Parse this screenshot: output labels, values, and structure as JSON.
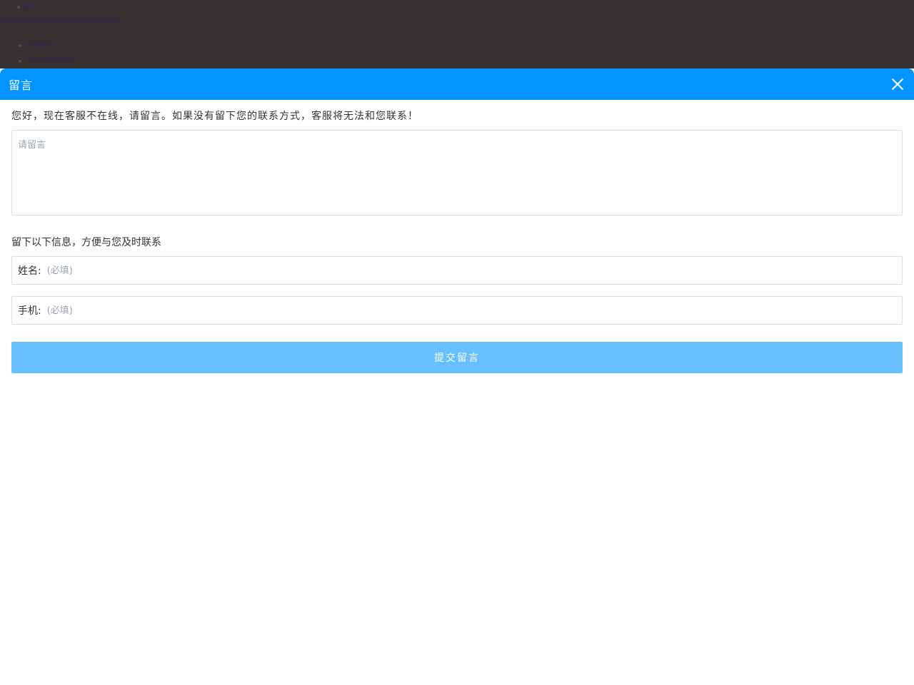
{
  "dialog": {
    "title": "留言",
    "notice": "您好，现在客服不在线，请留言。如果没有留下您的联系方式，客服将无法和您联系！",
    "message_placeholder": "请留言",
    "contact_prompt": "留下以下信息，方便与您及时联系",
    "fields": [
      {
        "label": "姓名:",
        "placeholder": "(必填)"
      },
      {
        "label": "手机:",
        "placeholder": "(必填)"
      }
    ],
    "submit_label": "提交留言"
  },
  "colors": {
    "header": "#0294ff",
    "submit_button": "#66bfff",
    "backdrop": "#363130"
  }
}
